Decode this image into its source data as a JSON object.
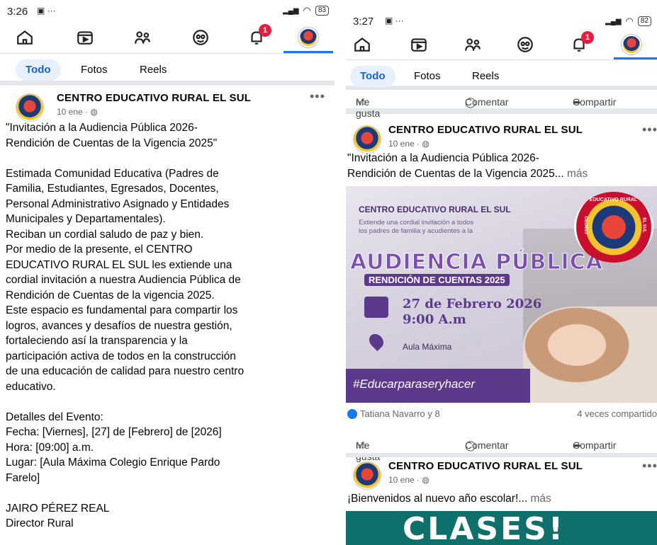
{
  "left": {
    "status": {
      "time": "3:26",
      "battery": "83"
    },
    "nav": {
      "notif_count": "1"
    },
    "filters": [
      "Todo",
      "Fotos",
      "Reels"
    ],
    "post": {
      "page_name": "CENTRO EDUCATIVO RURAL EL SUL",
      "date": "10 ene · ",
      "more": "•••",
      "body": [
        "\"Invitación a la Audiencia Pública 2026-",
        "Rendición de Cuentas de la Vigencia 2025\"",
        "",
        "Estimada Comunidad Educativa (Padres de",
        "Familia, Estudiantes, Egresados, Docentes,",
        "Personal Administrativo Asignado y Entidades",
        "Municipales y Departamentales).",
        "Reciban un cordial saludo de paz y bien.",
        "Por medio de la presente, el CENTRO",
        "EDUCATIVO RURAL EL SUL les extiende una",
        "cordial invitación a nuestra Audiencia Pública de",
        "Rendición de Cuentas de la vigencia 2025.",
        "Este espacio es fundamental para compartir los",
        "logros, avances y desafíos de nuestra gestión,",
        "fortaleciendo así la transparencia y la",
        "participación activa de todos en la construcción",
        "de una educación de calidad para nuestro centro",
        "educativo.",
        "",
        "Detalles del Evento:",
        "Fecha: [Viernes], [27] de [Febrero] de [2026]",
        "Hora: [09:00] a.m.",
        "Lugar: [Aula Máxima Colegio Enrique Pardo",
        "Farelo]",
        "",
        "JAIRO PÉREZ REAL",
        "Director Rural"
      ]
    }
  },
  "right": {
    "status": {
      "time": "3:27",
      "battery": "82"
    },
    "nav": {
      "notif_count": "1"
    },
    "filters": [
      "Todo",
      "Fotos",
      "Reels"
    ],
    "top_actions": {
      "like": "Me gusta",
      "comment": "Comentar",
      "share": "Compartir"
    },
    "post1": {
      "page_name": "CENTRO EDUCATIVO RURAL EL SUL",
      "date": "10 ene · ",
      "more": "•••",
      "line1": "\"Invitación a la Audiencia Pública 2026-",
      "line2": "Rendición de Cuentas de la Vigencia 2025... ",
      "more_link": "más",
      "banner": {
        "school": "CENTRO EDUCATIVO RURAL EL SUL",
        "sub1": "Extiende una cordial invitación a todos",
        "sub2": "los padres de familia y acudientes a la",
        "title": "AUDIENCIA PÚBLICA",
        "subtitle": "RENDICIÓN DE CUENTAS 2025",
        "date": "27 de Febrero 2026",
        "time": "9:00 A.m",
        "place": "Aula Máxima",
        "hashtag": "#Educarparaseryhacer",
        "crest_top": "EDUCATIVO RURAL",
        "crest_left": "CENTRO",
        "crest_right": "EL SUL"
      },
      "reactions": "Tatiana Navarro y 8",
      "shares": "4 veces compartido",
      "actions": {
        "like": "Me gusta",
        "comment": "Comentar",
        "share": "Compartir"
      }
    },
    "post2": {
      "page_name": "CENTRO EDUCATIVO RURAL EL SUL",
      "date": "10 ene · ",
      "more": "•••",
      "text": "¡Bienvenidos al nuevo año escolar!... ",
      "more_link": "más",
      "banner_text": "CLASES!"
    }
  }
}
